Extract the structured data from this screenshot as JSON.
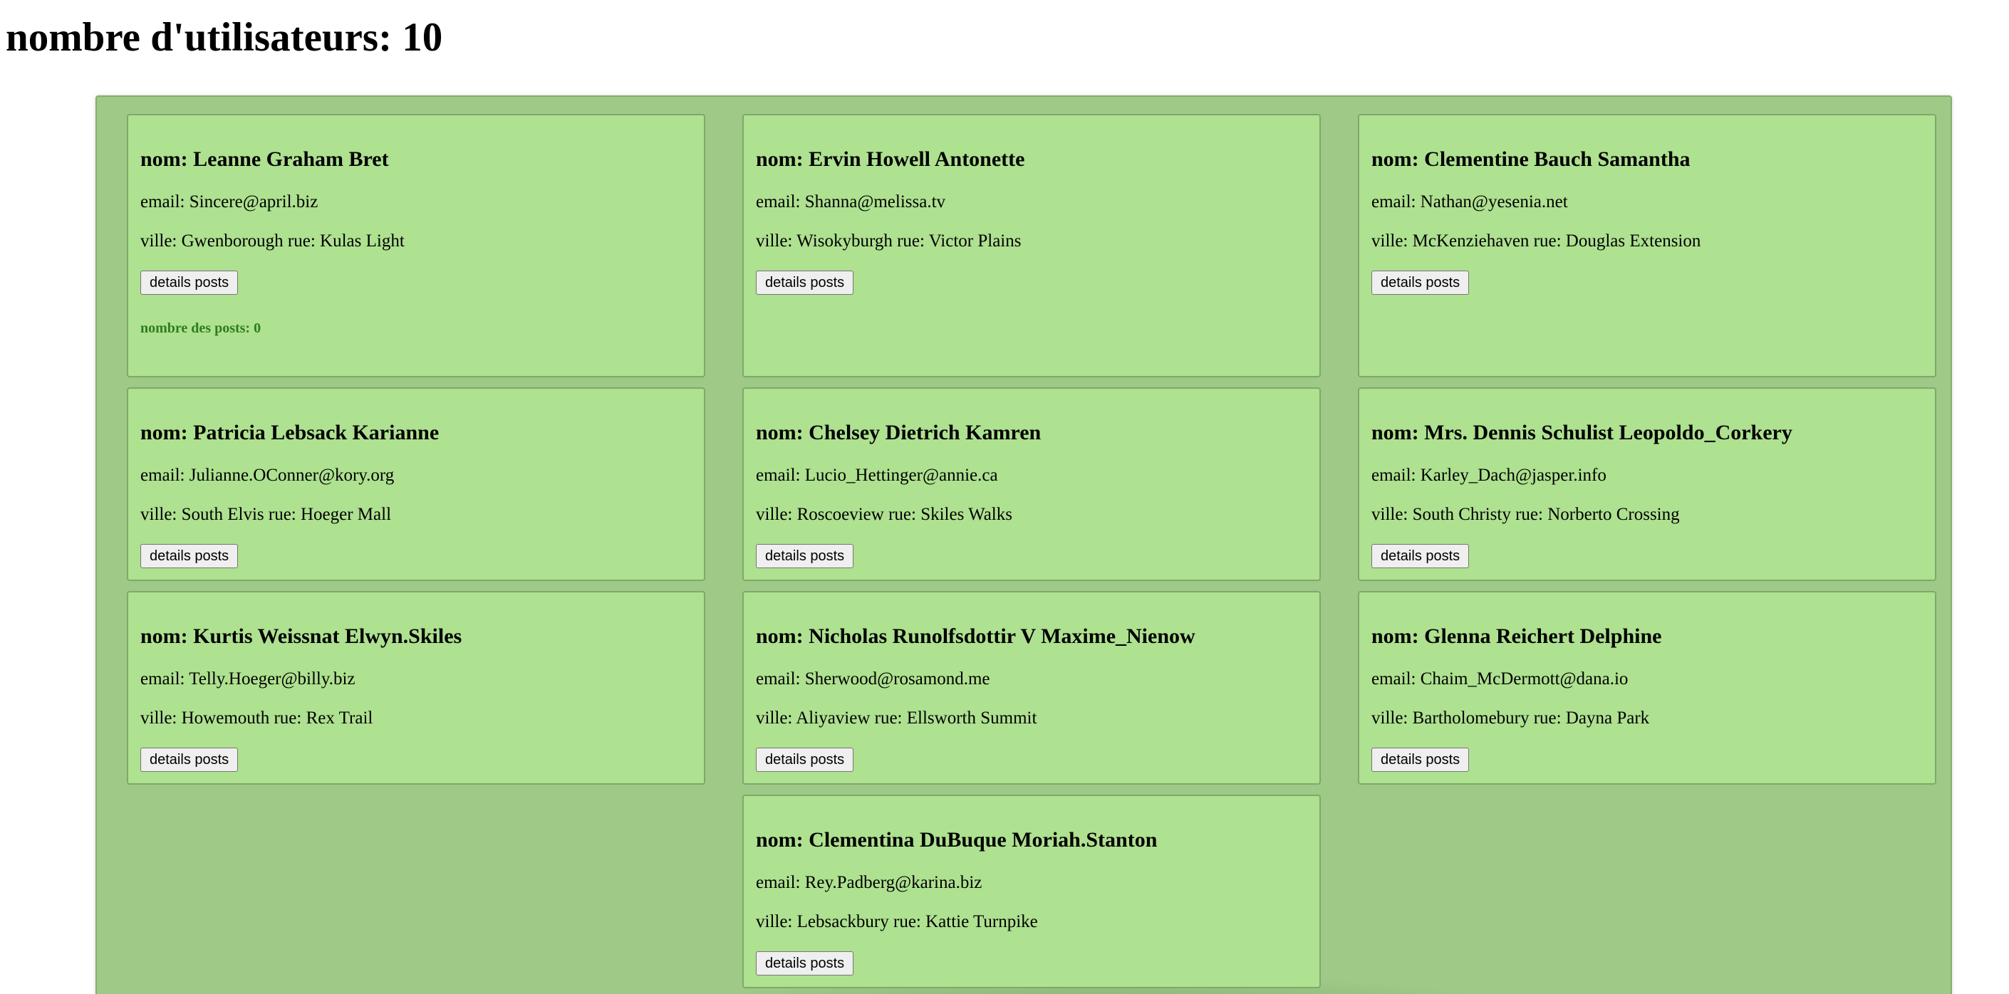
{
  "header": {
    "title": "nombre d'utilisateurs: 10"
  },
  "users": [
    {
      "name": "nom: Leanne Graham Bret",
      "email": "email: Sincere@april.biz",
      "address": "ville: Gwenborough rue: Kulas Light",
      "button": "details posts",
      "posts_count": "nombre des posts: 0"
    },
    {
      "name": "nom: Ervin Howell Antonette",
      "email": "email: Shanna@melissa.tv",
      "address": "ville: Wisokyburgh rue: Victor Plains",
      "button": "details posts"
    },
    {
      "name": "nom: Clementine Bauch Samantha",
      "email": "email: Nathan@yesenia.net",
      "address": "ville: McKenziehaven rue: Douglas Extension",
      "button": "details posts"
    },
    {
      "name": "nom: Patricia Lebsack Karianne",
      "email": "email: Julianne.OConner@kory.org",
      "address": "ville: South Elvis rue: Hoeger Mall",
      "button": "details posts"
    },
    {
      "name": "nom: Chelsey Dietrich Kamren",
      "email": "email: Lucio_Hettinger@annie.ca",
      "address": "ville: Roscoeview rue: Skiles Walks",
      "button": "details posts"
    },
    {
      "name": "nom: Mrs. Dennis Schulist Leopoldo_Corkery",
      "email": "email: Karley_Dach@jasper.info",
      "address": "ville: South Christy rue: Norberto Crossing",
      "button": "details posts"
    },
    {
      "name": "nom: Kurtis Weissnat Elwyn.Skiles",
      "email": "email: Telly.Hoeger@billy.biz",
      "address": "ville: Howemouth rue: Rex Trail",
      "button": "details posts"
    },
    {
      "name": "nom: Nicholas Runolfsdottir V Maxime_Nienow",
      "email": "email: Sherwood@rosamond.me",
      "address": "ville: Aliyaview rue: Ellsworth Summit",
      "button": "details posts"
    },
    {
      "name": "nom: Glenna Reichert Delphine",
      "email": "email: Chaim_McDermott@dana.io",
      "address": "ville: Bartholomebury rue: Dayna Park",
      "button": "details posts"
    },
    {
      "name": "nom: Clementina DuBuque Moriah.Stanton",
      "email": "email: Rey.Padberg@karina.biz",
      "address": "ville: Lebsackbury rue: Kattie Turnpike",
      "button": "details posts"
    }
  ]
}
